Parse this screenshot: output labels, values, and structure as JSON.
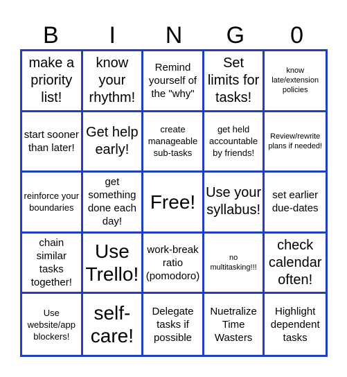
{
  "header": [
    "B",
    "I",
    "N",
    "G",
    "0"
  ],
  "colors": {
    "border": "#1f3fbf"
  },
  "cells": [
    {
      "text": "make a priority list!",
      "size": "s4"
    },
    {
      "text": "know your rhythm!",
      "size": "s4"
    },
    {
      "text": "Remind yourself of the \"why\"",
      "size": "s3"
    },
    {
      "text": "Set limits for tasks!",
      "size": "s4"
    },
    {
      "text": "know late/extension policies",
      "size": "s1"
    },
    {
      "text": "start sooner than later!",
      "size": "s3"
    },
    {
      "text": "Get help early!",
      "size": "s4"
    },
    {
      "text": "create manageable sub-tasks",
      "size": "s2"
    },
    {
      "text": "get held accountable by friends!",
      "size": "s2"
    },
    {
      "text": "Review/rewrite plans if needed!",
      "size": "s1"
    },
    {
      "text": "reinforce your boundaries",
      "size": "s2"
    },
    {
      "text": "get something done each day!",
      "size": "s3"
    },
    {
      "text": "Free!",
      "size": "s5"
    },
    {
      "text": "Use your syllabus!",
      "size": "s4"
    },
    {
      "text": "set earlier due-dates",
      "size": "s3"
    },
    {
      "text": "chain similar tasks together!",
      "size": "s3"
    },
    {
      "text": "Use Trello!",
      "size": "s5"
    },
    {
      "text": "work-break ratio (pomodoro)",
      "size": "s3"
    },
    {
      "text": "no multitasking!!!",
      "size": "s1"
    },
    {
      "text": "check calendar often!",
      "size": "s4"
    },
    {
      "text": "Use website/app blockers!",
      "size": "s2"
    },
    {
      "text": "self-care!",
      "size": "s5"
    },
    {
      "text": "Delegate tasks if possible",
      "size": "s3"
    },
    {
      "text": "Nuetralize Time Wasters",
      "size": "s3"
    },
    {
      "text": "Highlight dependent tasks",
      "size": "s3"
    }
  ]
}
